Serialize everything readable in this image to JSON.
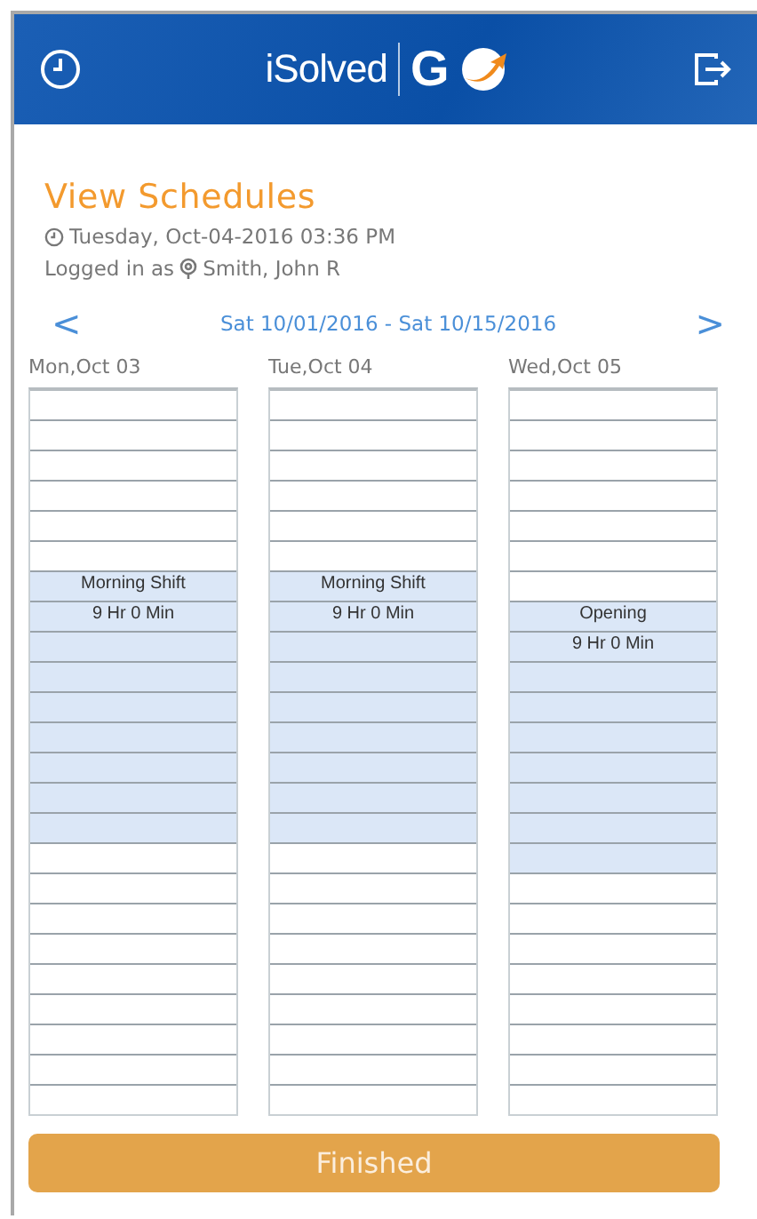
{
  "header": {
    "brand": "iSolved",
    "product": "G"
  },
  "title": "View Schedules",
  "datetime": "Tuesday, Oct-04-2016 03:36 PM",
  "logged_in": {
    "label": "Logged in as",
    "user": "Smith, John R"
  },
  "range": {
    "prev": "<",
    "label": "Sat 10/01/2016 - Sat 10/15/2016",
    "next": ">"
  },
  "days": [
    {
      "label": "Mon,Oct 03",
      "slots": [
        {
          "booked": false
        },
        {
          "booked": false
        },
        {
          "booked": false
        },
        {
          "booked": false
        },
        {
          "booked": false
        },
        {
          "booked": false
        },
        {
          "booked": true,
          "text": "Morning Shift"
        },
        {
          "booked": true,
          "text": "9 Hr 0 Min"
        },
        {
          "booked": true
        },
        {
          "booked": true
        },
        {
          "booked": true
        },
        {
          "booked": true
        },
        {
          "booked": true
        },
        {
          "booked": true
        },
        {
          "booked": true
        },
        {
          "booked": false
        },
        {
          "booked": false
        },
        {
          "booked": false
        },
        {
          "booked": false
        },
        {
          "booked": false
        },
        {
          "booked": false
        },
        {
          "booked": false
        },
        {
          "booked": false
        },
        {
          "booked": false
        }
      ]
    },
    {
      "label": "Tue,Oct 04",
      "slots": [
        {
          "booked": false
        },
        {
          "booked": false
        },
        {
          "booked": false
        },
        {
          "booked": false
        },
        {
          "booked": false
        },
        {
          "booked": false
        },
        {
          "booked": true,
          "text": "Morning Shift"
        },
        {
          "booked": true,
          "text": "9 Hr 0 Min"
        },
        {
          "booked": true
        },
        {
          "booked": true
        },
        {
          "booked": true
        },
        {
          "booked": true
        },
        {
          "booked": true
        },
        {
          "booked": true
        },
        {
          "booked": true
        },
        {
          "booked": false
        },
        {
          "booked": false
        },
        {
          "booked": false
        },
        {
          "booked": false
        },
        {
          "booked": false
        },
        {
          "booked": false
        },
        {
          "booked": false
        },
        {
          "booked": false
        },
        {
          "booked": false
        }
      ]
    },
    {
      "label": "Wed,Oct 05",
      "slots": [
        {
          "booked": false
        },
        {
          "booked": false
        },
        {
          "booked": false
        },
        {
          "booked": false
        },
        {
          "booked": false
        },
        {
          "booked": false
        },
        {
          "booked": false
        },
        {
          "booked": true,
          "text": "Opening"
        },
        {
          "booked": true,
          "text": "9 Hr 0 Min"
        },
        {
          "booked": true
        },
        {
          "booked": true
        },
        {
          "booked": true
        },
        {
          "booked": true
        },
        {
          "booked": true
        },
        {
          "booked": true
        },
        {
          "booked": true
        },
        {
          "booked": false
        },
        {
          "booked": false
        },
        {
          "booked": false
        },
        {
          "booked": false
        },
        {
          "booked": false
        },
        {
          "booked": false
        },
        {
          "booked": false
        },
        {
          "booked": false
        }
      ]
    }
  ],
  "button": "Finished"
}
